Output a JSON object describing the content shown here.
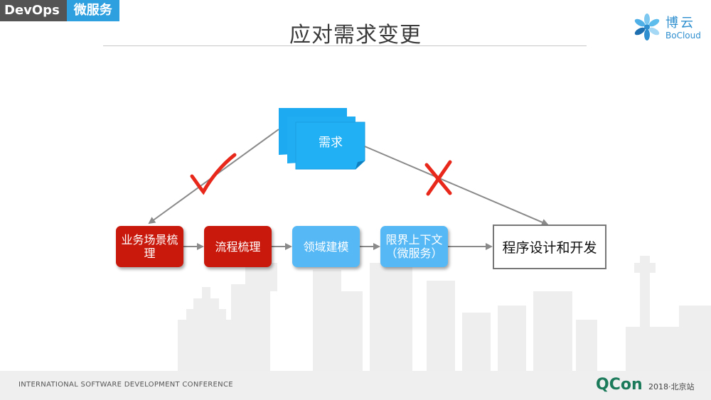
{
  "header": {
    "tag_devops": "DevOps",
    "tag_micro": "微服务",
    "title": "应对需求变更"
  },
  "logo": {
    "name_cn": "博云",
    "name_en": "BoCloud"
  },
  "diagram": {
    "requirement": "需求",
    "steps": [
      {
        "label": "业务场景梳\n理",
        "color": "#c8190c"
      },
      {
        "label": "流程梳理",
        "color": "#c8190c"
      },
      {
        "label": "领域建模",
        "color": "#56b8f4"
      },
      {
        "label": "限界上下文\n（微服务）",
        "color": "#56b8f4"
      }
    ],
    "result": "程序设计和开发",
    "mark_good": "check",
    "mark_bad": "cross"
  },
  "footer": {
    "conference": "INTERNATIONAL SOFTWARE DEVELOPMENT CONFERENCE",
    "brand": "QCon",
    "edition": "2018·北京站"
  }
}
